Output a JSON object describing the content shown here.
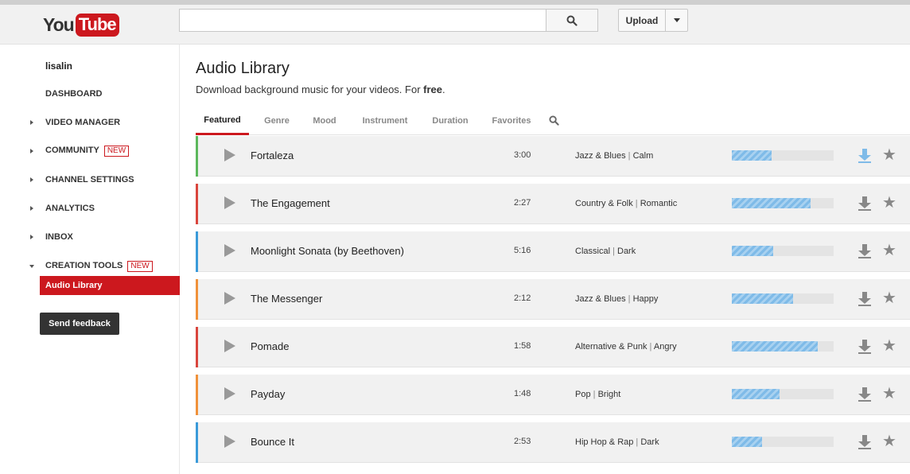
{
  "header": {
    "logo_you": "You",
    "logo_tube": "Tube",
    "search_value": "",
    "upload_label": "Upload",
    "icons": {
      "search": "search-icon",
      "dropdown": "chevron-down-icon"
    }
  },
  "sidebar": {
    "username": "lisalin",
    "items": [
      {
        "label": "DASHBOARD",
        "arrow": "none",
        "badge": ""
      },
      {
        "label": "VIDEO MANAGER",
        "arrow": "right",
        "badge": ""
      },
      {
        "label": "COMMUNITY",
        "arrow": "right",
        "badge": "NEW"
      },
      {
        "label": "CHANNEL SETTINGS",
        "arrow": "right",
        "badge": ""
      },
      {
        "label": "ANALYTICS",
        "arrow": "right",
        "badge": ""
      },
      {
        "label": "INBOX",
        "arrow": "right",
        "badge": ""
      },
      {
        "label": "CREATION TOOLS",
        "arrow": "down",
        "badge": "NEW"
      }
    ],
    "active_subitem": "Audio Library",
    "feedback_label": "Send feedback"
  },
  "main": {
    "title": "Audio Library",
    "subtitle_prefix": "Download background music for your videos. For ",
    "subtitle_bold": "free",
    "subtitle_suffix": ".",
    "tabs": [
      {
        "label": "Featured",
        "active": true
      },
      {
        "label": "Genre",
        "active": false
      },
      {
        "label": "Mood",
        "active": false
      },
      {
        "label": "Instrument",
        "active": false
      },
      {
        "label": "Duration",
        "active": false
      },
      {
        "label": "Favorites",
        "active": false
      }
    ],
    "tracks": [
      {
        "title": "Fortaleza",
        "duration": "3:00",
        "genre": "Jazz & Blues",
        "mood": "Calm",
        "popularity": 0.39,
        "color": "#5cb85c",
        "download_highlight": true
      },
      {
        "title": "The Engagement",
        "duration": "2:27",
        "genre": "Country & Folk",
        "mood": "Romantic",
        "popularity": 0.77,
        "color": "#d9453d",
        "download_highlight": false
      },
      {
        "title": "Moonlight Sonata (by Beethoven)",
        "duration": "5:16",
        "genre": "Classical",
        "mood": "Dark",
        "popularity": 0.41,
        "color": "#3a9ad9",
        "download_highlight": false
      },
      {
        "title": "The Messenger",
        "duration": "2:12",
        "genre": "Jazz & Blues",
        "mood": "Happy",
        "popularity": 0.6,
        "color": "#f0913a",
        "download_highlight": false
      },
      {
        "title": "Pomade",
        "duration": "1:58",
        "genre": "Alternative & Punk",
        "mood": "Angry",
        "popularity": 0.84,
        "color": "#d9453d",
        "download_highlight": false
      },
      {
        "title": "Payday",
        "duration": "1:48",
        "genre": "Pop",
        "mood": "Bright",
        "popularity": 0.47,
        "color": "#f0913a",
        "download_highlight": false
      },
      {
        "title": "Bounce It",
        "duration": "2:53",
        "genre": "Hip Hop & Rap",
        "mood": "Dark",
        "popularity": 0.3,
        "color": "#3a9ad9",
        "download_highlight": false
      }
    ]
  },
  "colors": {
    "brand_red": "#cc181e",
    "download_blue": "#7fbbe8"
  }
}
